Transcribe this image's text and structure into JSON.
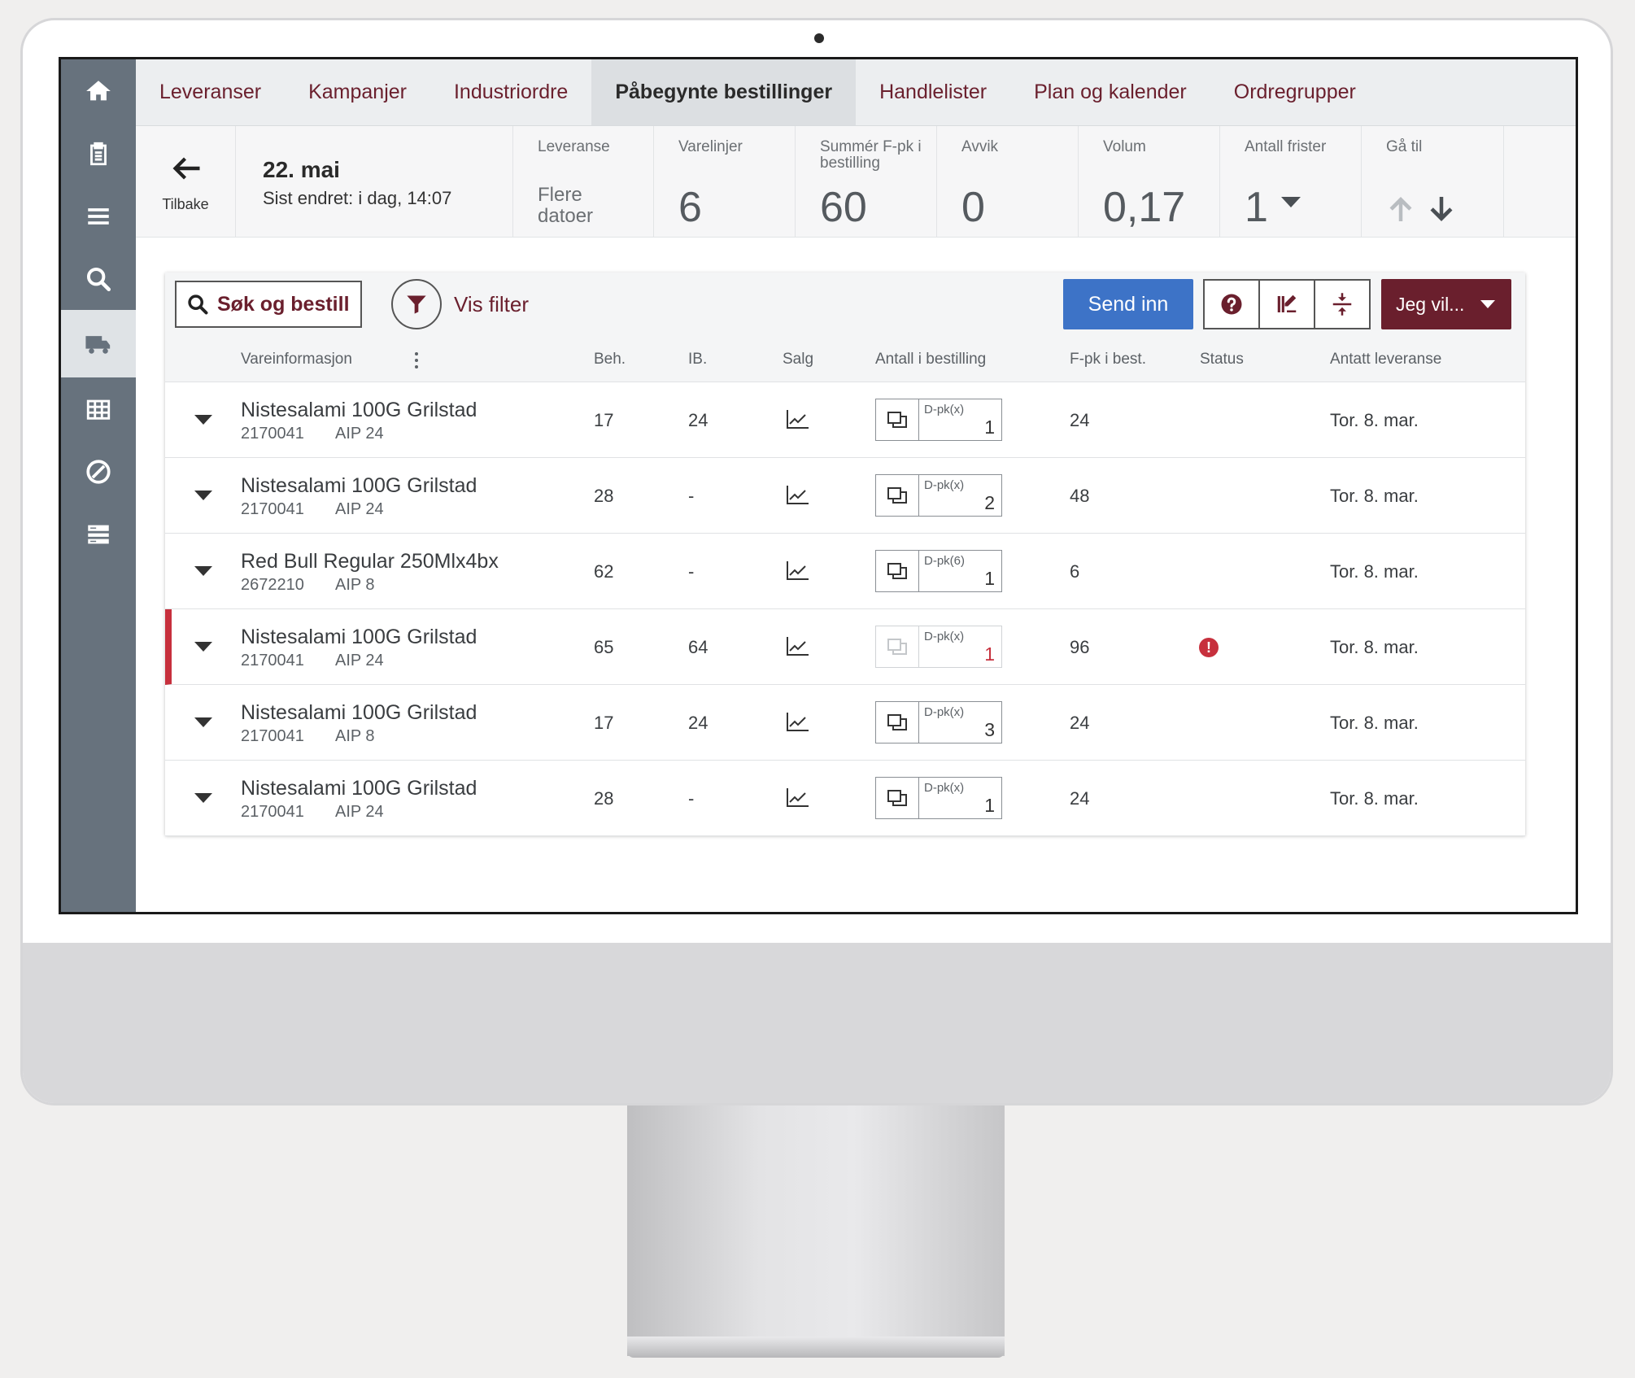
{
  "sidebar": {
    "icons": [
      "home-icon",
      "clipboard-icon",
      "menu-icon",
      "search-icon",
      "truck-icon",
      "calendar-grid-icon",
      "block-icon",
      "list-detail-icon"
    ],
    "active_index": 4
  },
  "tabs": [
    {
      "label": "Leveranser"
    },
    {
      "label": "Kampanjer"
    },
    {
      "label": "Industriordre"
    },
    {
      "label": "Påbegynte bestillinger",
      "active": true
    },
    {
      "label": "Handlelister"
    },
    {
      "label": "Plan og kalender"
    },
    {
      "label": "Ordregrupper"
    }
  ],
  "summary": {
    "back_label": "Tilbake",
    "date_title": "22. mai",
    "date_sub": "Sist endret: i dag, 14:07",
    "stats": [
      {
        "label": "Leveranse",
        "value": "Flere datoer"
      },
      {
        "label": "Varelinjer",
        "value": "6"
      },
      {
        "label": "Summér F-pk i bestilling",
        "value": "60"
      },
      {
        "label": "Avvik",
        "value": "0"
      },
      {
        "label": "Volum",
        "value": "0,17"
      },
      {
        "label": "Antall frister",
        "value": "1"
      },
      {
        "label": "Gå til",
        "value": ""
      }
    ]
  },
  "toolbar": {
    "search_label": "Søk og bestill",
    "filter_label": "Vis filter",
    "send_label": "Send inn",
    "jeg_label": "Jeg vil..."
  },
  "table": {
    "headers": {
      "info": "Vareinformasjon",
      "beh": "Beh.",
      "ib": "IB.",
      "salg": "Salg",
      "antall": "Antall i bestilling",
      "fpk": "F-pk i best.",
      "status": "Status",
      "lev": "Antatt leveranse"
    },
    "rows": [
      {
        "name": "Nistesalami 100G Grilstad",
        "code": "2170041",
        "aip": "AIP 24",
        "beh": "17",
        "ib": "24",
        "qty_label": "D-pk(x)",
        "qty": "1",
        "fpk": "24",
        "status": "",
        "lev": "Tor. 8. mar."
      },
      {
        "name": "Nistesalami 100G Grilstad",
        "code": "2170041",
        "aip": "AIP 24",
        "beh": "28",
        "ib": "-",
        "qty_label": "D-pk(x)",
        "qty": "2",
        "fpk": "48",
        "status": "",
        "lev": "Tor. 8. mar."
      },
      {
        "name": "Red Bull Regular 250Mlx4bx",
        "code": "2672210",
        "aip": "AIP 8",
        "beh": "62",
        "ib": "-",
        "qty_label": "D-pk(6)",
        "qty": "1",
        "fpk": "6",
        "status": "",
        "lev": "Tor. 8. mar."
      },
      {
        "name": "Nistesalami 100G Grilstad",
        "code": "2170041",
        "aip": "AIP 24",
        "beh": "65",
        "ib": "64",
        "qty_label": "D-pk(x)",
        "qty": "1",
        "fpk": "96",
        "status": "!",
        "lev": "Tor. 8. mar."
      },
      {
        "name": "Nistesalami 100G Grilstad",
        "code": "2170041",
        "aip": "AIP 8",
        "beh": "17",
        "ib": "24",
        "qty_label": "D-pk(x)",
        "qty": "3",
        "fpk": "24",
        "status": "",
        "lev": "Tor. 8. mar."
      },
      {
        "name": "Nistesalami 100G Grilstad",
        "code": "2170041",
        "aip": "AIP 24",
        "beh": "28",
        "ib": "-",
        "qty_label": "D-pk(x)",
        "qty": "1",
        "fpk": "24",
        "status": "",
        "lev": "Tor. 8. mar."
      }
    ]
  },
  "colors": {
    "brand": "#6a1f2d",
    "primary": "#3d73c7",
    "sidebar": "#67727d",
    "error": "#c7303d"
  }
}
